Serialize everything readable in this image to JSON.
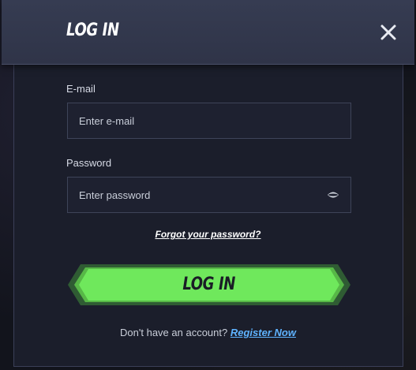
{
  "dialog": {
    "title": "LOG IN"
  },
  "email": {
    "label": "E-mail",
    "placeholder": "Enter e-mail",
    "value": ""
  },
  "password": {
    "label": "Password",
    "placeholder": "Enter password",
    "value": ""
  },
  "forgot_link": "Forgot your password?",
  "submit_label": "LOG IN",
  "register": {
    "prompt": "Don't have an account?",
    "link": "Register Now"
  },
  "icons": {
    "close": "close-icon",
    "password_toggle": "eye-icon"
  },
  "colors": {
    "accent_green": "#6fe85c",
    "link_blue": "#5fb3ff",
    "panel": "#1b1e2b",
    "header": "#343a4f"
  }
}
